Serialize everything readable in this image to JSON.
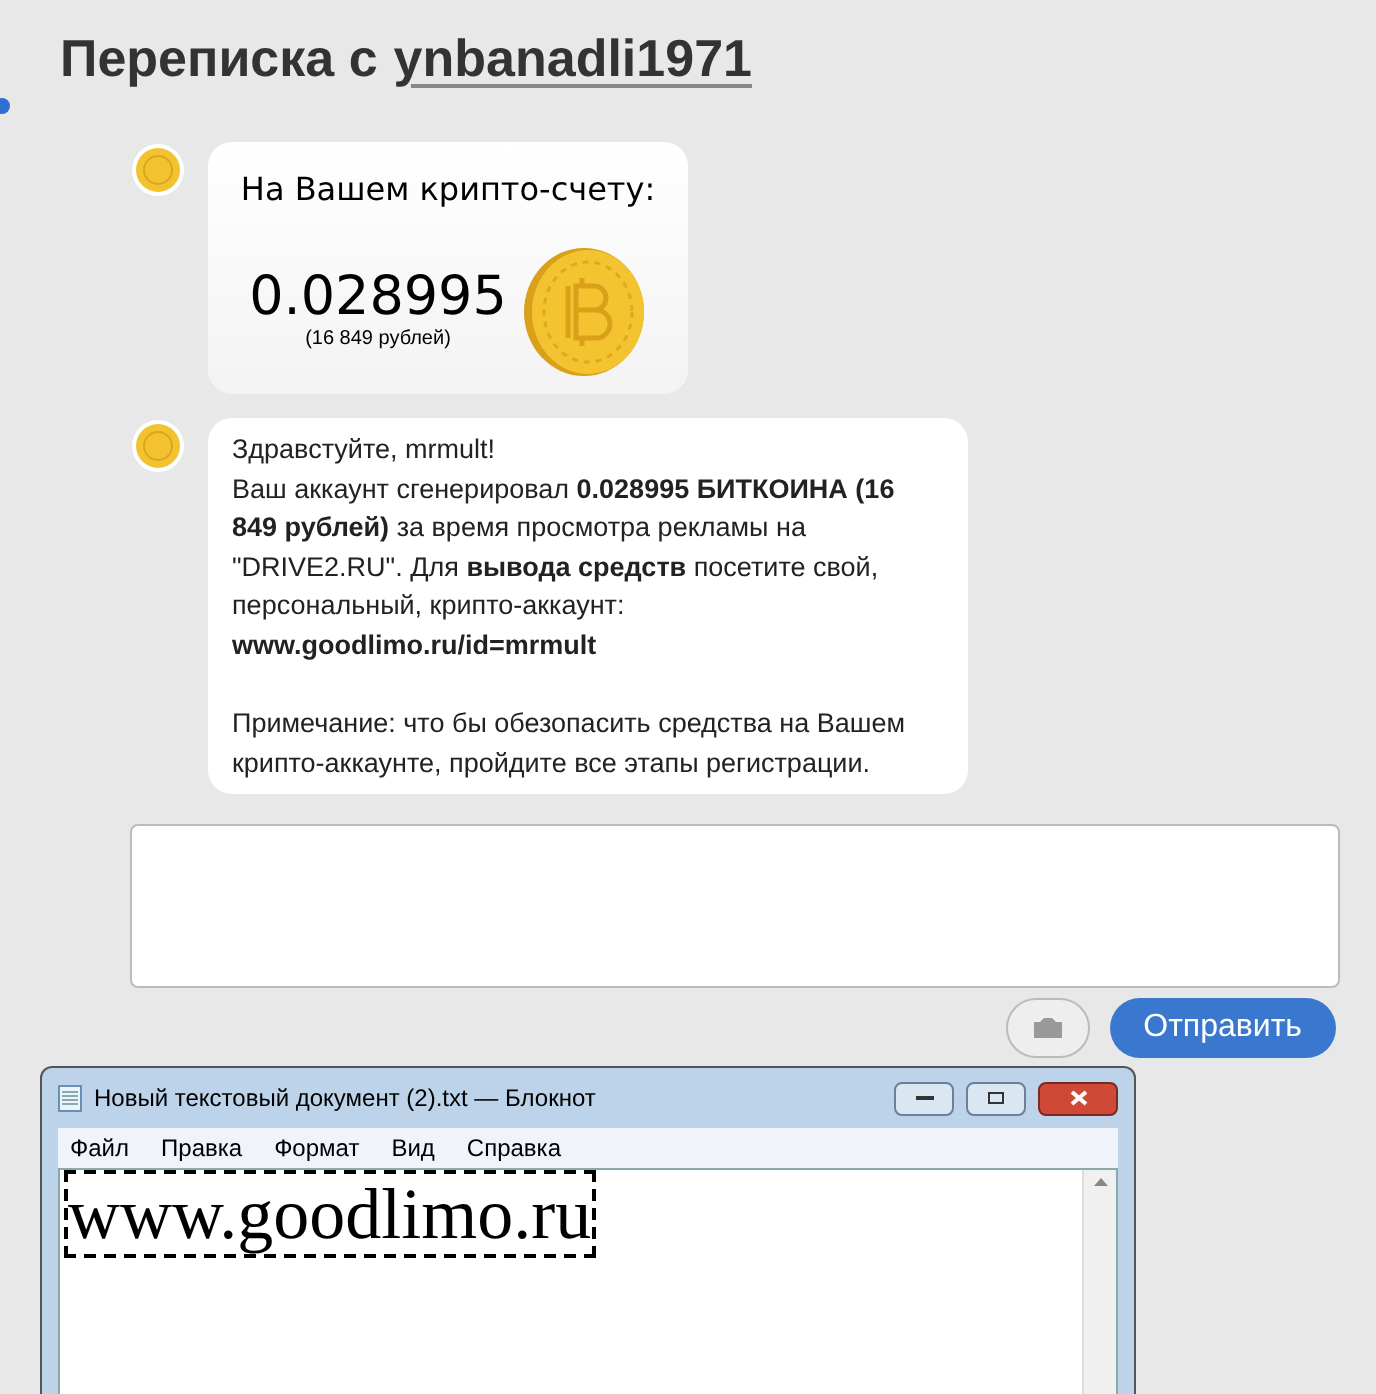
{
  "header": {
    "prefix": "Переписка с",
    "username": "ynbanadli1971"
  },
  "messages": [
    {
      "kind": "balance",
      "title": "На Вашем крипто-счету:",
      "amount": "0.028995",
      "rubles": "(16 849 рублей)"
    },
    {
      "kind": "text",
      "paragraphs": [
        "Здравстуйте,  mrmult!\nВаш аккаунт сгенерировал **0.028995 БИТКОИНА (16 849 рублей)** за время просмотра рекламы на \"DRIVE2.RU\". Для **вывода средств** посетите свой, персональный,  крипто-аккаунт:\n**www.goodlimo.ru/id=mrmult**",
        "Примечание: что бы обезопасить средства на Вашем крипто-аккаунте,  пройдите все этапы регистрации."
      ]
    }
  ],
  "send_button": "Отправить",
  "notepad": {
    "title": "Новый текстовый документ (2).txt — Блокнот",
    "menu": [
      "Файл",
      "Правка",
      "Формат",
      "Вид",
      "Справка"
    ],
    "content": "www.goodlimo.ru"
  }
}
